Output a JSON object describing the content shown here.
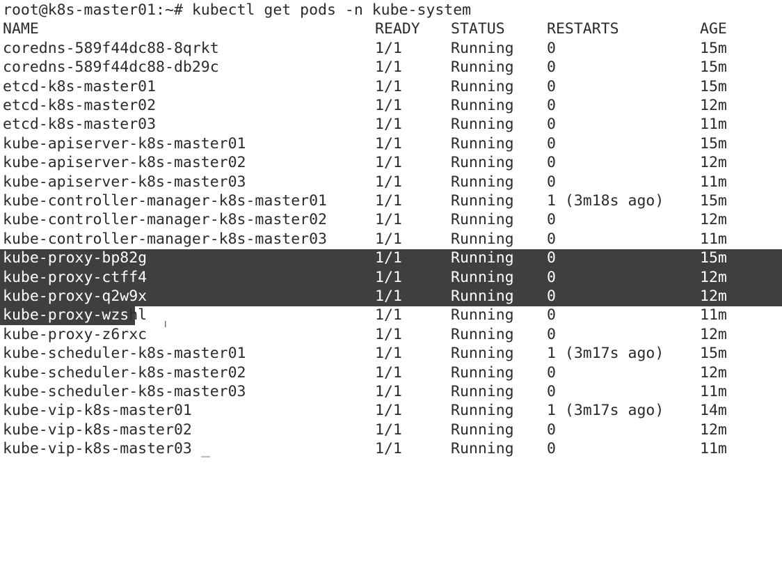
{
  "terminal": {
    "prompt": "root@k8s-master01:~#",
    "command": "kubectl get pods -n kube-system",
    "headers": {
      "name": "NAME",
      "ready": "READY",
      "status": "STATUS",
      "restarts": "RESTARTS",
      "age": "AGE"
    },
    "rows": [
      {
        "name": "coredns-589f44dc88-8qrkt",
        "ready": "1/1",
        "status": "Running",
        "restarts": "0",
        "age": "15m"
      },
      {
        "name": "coredns-589f44dc88-db29c",
        "ready": "1/1",
        "status": "Running",
        "restarts": "0",
        "age": "15m"
      },
      {
        "name": "etcd-k8s-master01",
        "ready": "1/1",
        "status": "Running",
        "restarts": "0",
        "age": "15m"
      },
      {
        "name": "etcd-k8s-master02",
        "ready": "1/1",
        "status": "Running",
        "restarts": "0",
        "age": "12m"
      },
      {
        "name": "etcd-k8s-master03",
        "ready": "1/1",
        "status": "Running",
        "restarts": "0",
        "age": "11m"
      },
      {
        "name": "kube-apiserver-k8s-master01",
        "ready": "1/1",
        "status": "Running",
        "restarts": "0",
        "age": "15m"
      },
      {
        "name": "kube-apiserver-k8s-master02",
        "ready": "1/1",
        "status": "Running",
        "restarts": "0",
        "age": "12m"
      },
      {
        "name": "kube-apiserver-k8s-master03",
        "ready": "1/1",
        "status": "Running",
        "restarts": "0",
        "age": "11m"
      },
      {
        "name": "kube-controller-manager-k8s-master01",
        "ready": "1/1",
        "status": "Running",
        "restarts": "1 (3m18s ago)",
        "age": "15m"
      },
      {
        "name": "kube-controller-manager-k8s-master02",
        "ready": "1/1",
        "status": "Running",
        "restarts": "0",
        "age": "12m"
      },
      {
        "name": "kube-controller-manager-k8s-master03",
        "ready": "1/1",
        "status": "Running",
        "restarts": "0",
        "age": "11m"
      },
      {
        "name": "kube-proxy-bp82g",
        "ready": "1/1",
        "status": "Running",
        "restarts": "0",
        "age": "15m"
      },
      {
        "name": "kube-proxy-ctff4",
        "ready": "1/1",
        "status": "Running",
        "restarts": "0",
        "age": "12m"
      },
      {
        "name": "kube-proxy-q2w9x",
        "ready": "1/1",
        "status": "Running",
        "restarts": "0",
        "age": "12m"
      },
      {
        "name_selected": "kube-proxy-wzs",
        "name_rest": "hl",
        "ready": "1/1",
        "status": "Running",
        "restarts": "0",
        "age": "11m"
      },
      {
        "name": "kube-proxy-z6rxc",
        "ready": "1/1",
        "status": "Running",
        "restarts": "0",
        "age": "12m"
      },
      {
        "name": "kube-scheduler-k8s-master01",
        "ready": "1/1",
        "status": "Running",
        "restarts": "1 (3m17s ago)",
        "age": "15m"
      },
      {
        "name": "kube-scheduler-k8s-master02",
        "ready": "1/1",
        "status": "Running",
        "restarts": "0",
        "age": "12m"
      },
      {
        "name": "kube-scheduler-k8s-master03",
        "ready": "1/1",
        "status": "Running",
        "restarts": "0",
        "age": "11m"
      },
      {
        "name": "kube-vip-k8s-master01",
        "ready": "1/1",
        "status": "Running",
        "restarts": "1 (3m17s ago)",
        "age": "14m"
      },
      {
        "name": "kube-vip-k8s-master02",
        "ready": "1/1",
        "status": "Running",
        "restarts": "0",
        "age": "12m"
      },
      {
        "name": "kube-vip-k8s-master03",
        "ready": "1/1",
        "status": "Running",
        "restarts": "0",
        "age": "11m"
      }
    ],
    "colors": {
      "background": "#ffffff",
      "text": "#2b2b2b",
      "selection": "#3f3f3f",
      "selection_text": "#ffffff"
    }
  }
}
